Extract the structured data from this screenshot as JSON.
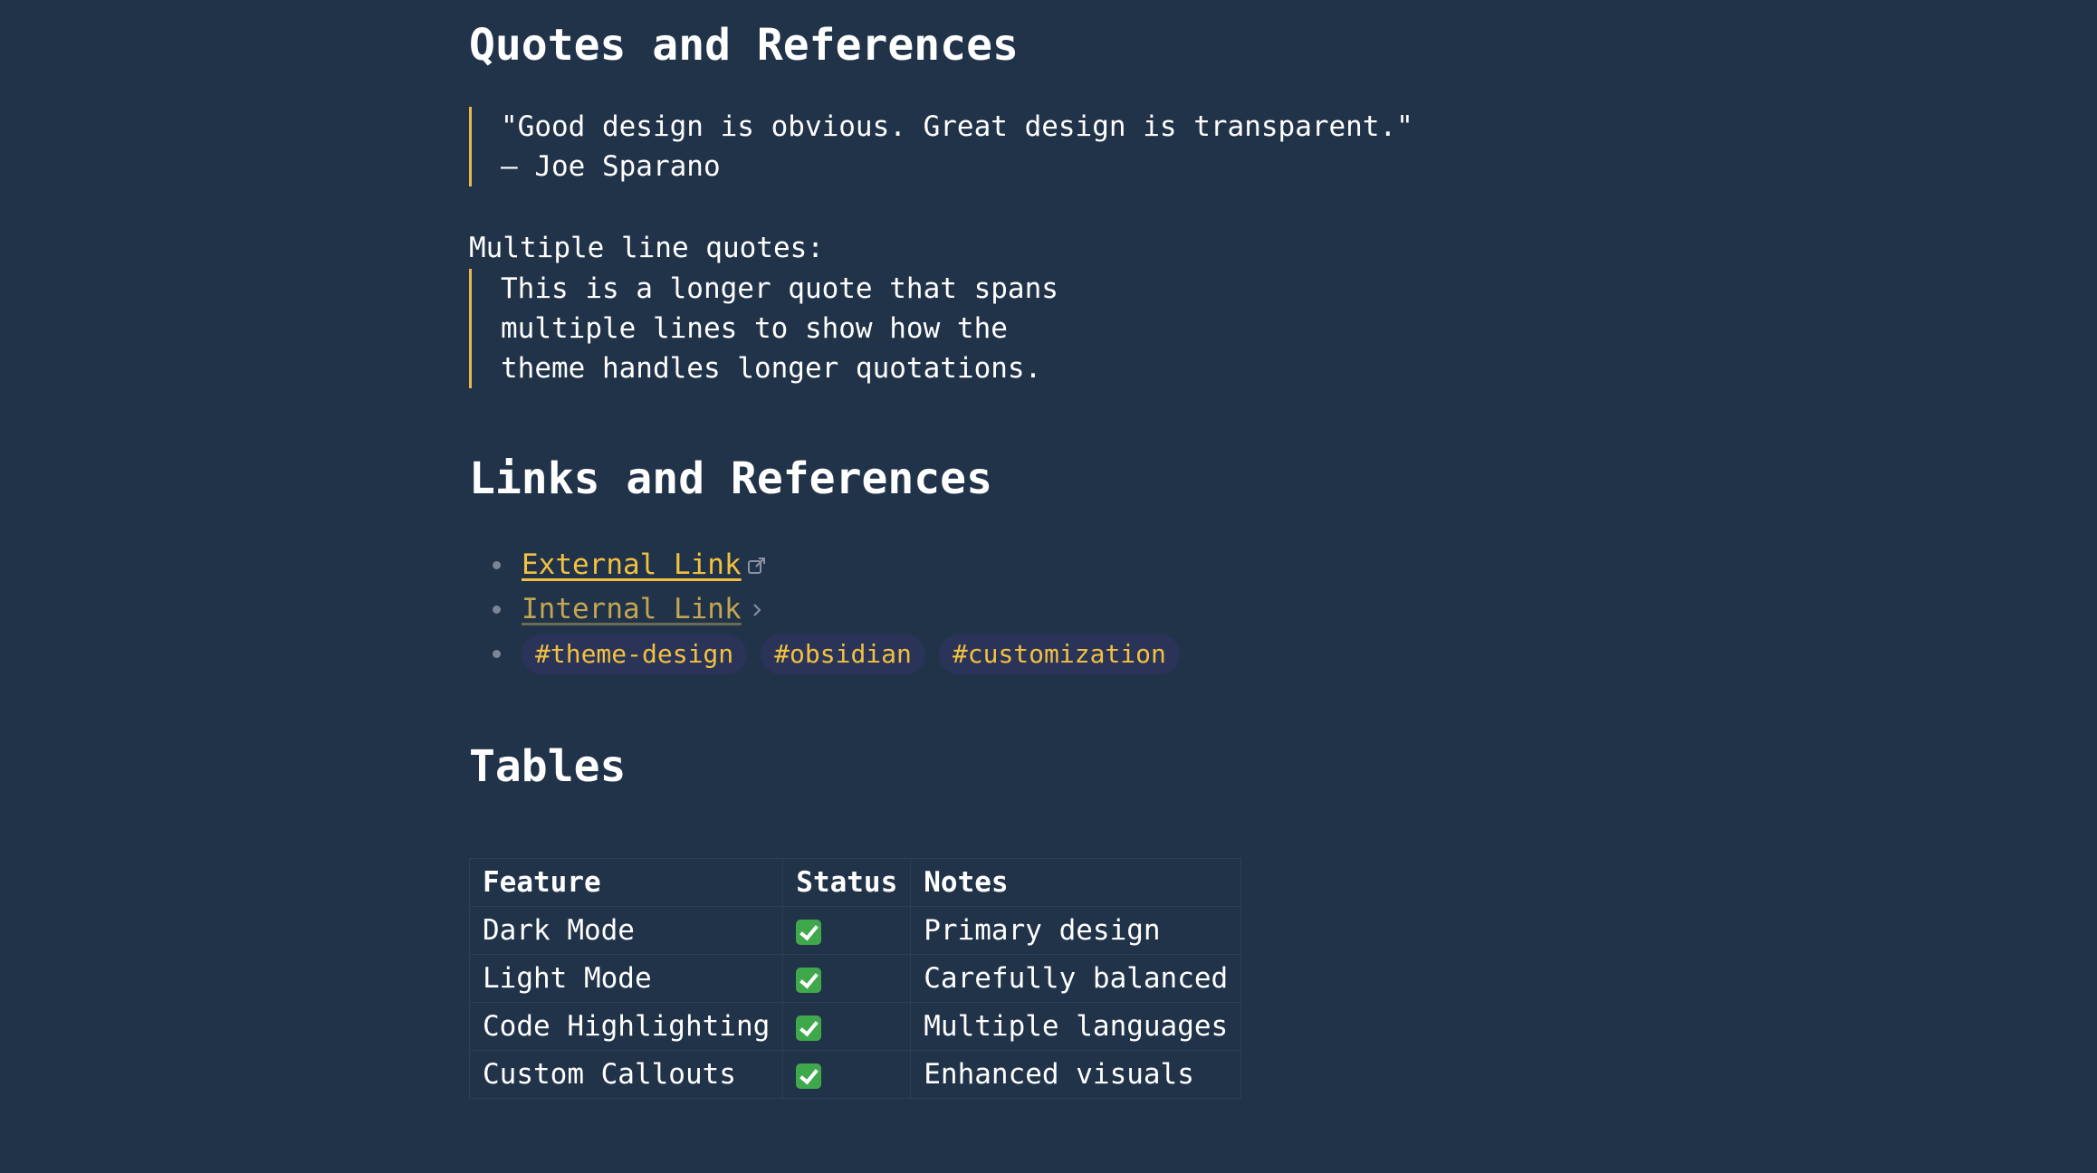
{
  "sections": {
    "quotes_heading": "Quotes and References",
    "links_heading": "Links and References",
    "tables_heading": "Tables"
  },
  "quote1": "\"Good design is obvious. Great design is transparent.\"\n— Joe Sparano",
  "multiline_label": "Multiple line quotes:",
  "quote2": "This is a longer quote that spans\nmultiple lines to show how the\ntheme handles longer quotations.",
  "links": {
    "external": "External Link",
    "internal": "Internal Link",
    "tags": [
      "#theme-design",
      "#obsidian",
      "#customization"
    ]
  },
  "table": {
    "headers": [
      "Feature",
      "Status",
      "Notes"
    ],
    "rows": [
      {
        "feature": "Dark Mode",
        "status": "✅",
        "notes": "Primary design"
      },
      {
        "feature": "Light Mode",
        "status": "✅",
        "notes": "Carefully balanced"
      },
      {
        "feature": "Code Highlighting",
        "status": "✅",
        "notes": "Multiple languages"
      },
      {
        "feature": "Custom Callouts",
        "status": "✅",
        "notes": "Enhanced visuals"
      }
    ]
  },
  "colors": {
    "background": "#213349",
    "accent": "#f2c140",
    "quote_border": "#e8b84a",
    "tag_bg": "#2a3358"
  },
  "icons": {
    "external": "external-link-icon",
    "internal": "chevron-right-icon",
    "status": "check-box-icon"
  }
}
